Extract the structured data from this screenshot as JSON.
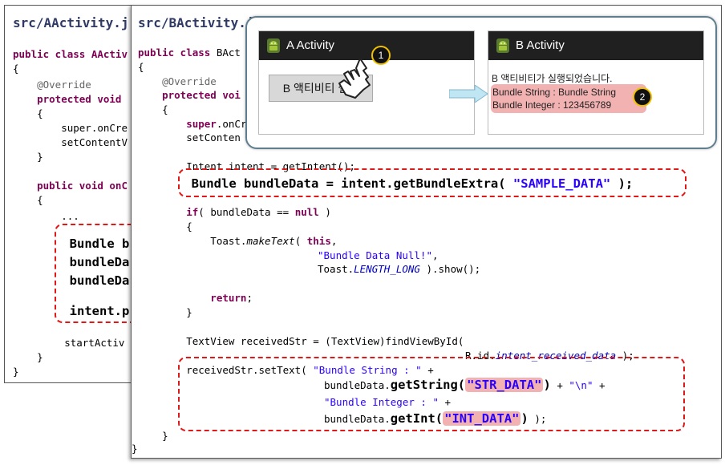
{
  "panelA": {
    "title": "src/AActivity.j",
    "lines": [
      "public class AActiv",
      "{",
      "    @Override",
      "    protected void",
      "    {",
      "        super.onCre",
      "        setContentV",
      "    }",
      "",
      "    public void onC",
      "    {",
      "        ...",
      "",
      "        Bundle b",
      "        bundleDa",
      "        bundleDa",
      "",
      "        intent.p",
      "",
      "        startActiv",
      "    }",
      "}"
    ]
  },
  "panelB": {
    "title": "src/BActivity.j",
    "code": {
      "l1_kw": "public class",
      "l1_rest": " BAct",
      "l2": "{",
      "l3": "    @Override",
      "l4_kw": "    protected voi",
      "l5": "    {",
      "l6_a": "        super",
      "l6_b": ".onCr",
      "l7": "        setConten",
      "l8": "        Intent intent = getIntent();",
      "l9_a": "        Bundle bundleData = intent.getBundleExtra( ",
      "l9_str": "\"SAMPLE_DATA\"",
      "l9_b": " );",
      "l10_kw": "        if",
      "l10_a": "( bundleData == ",
      "l10_null": "null",
      "l10_b": " )",
      "l11": "        {",
      "l12_a": "            Toast.",
      "l12_m": "makeText",
      "l12_b": "( ",
      "l12_this": "this",
      "l12_c": ",",
      "l13_str": "\"Bundle Data Null!\"",
      "l13_b": ",",
      "l14_a": "Toast.",
      "l14_f": "LENGTH_LONG",
      "l14_b": " ).show();",
      "l15_kw": "            return",
      "l15_b": ";",
      "l16": "        }",
      "l17": "        TextView receivedStr = (TextView)findViewById(",
      "l18_a": "R.id.",
      "l18_f": "intent_received_data",
      "l18_b": " );",
      "l19_a": "        receivedStr.setText( ",
      "l19_str": "\"Bundle String : \"",
      "l19_b": " +",
      "l20_a": "bundleData.",
      "l20_m": "getString(",
      "l20_str": "\"STR_DATA\"",
      "l20_c": ")",
      "l20_d": " + ",
      "l20_nl": "\"\\n\"",
      "l20_e": " +",
      "l21_str": "\"Bundle Integer : \"",
      "l21_b": " +",
      "l22_a": "bundleData.",
      "l22_m": "getInt(",
      "l22_str": "\"INT_DATA\"",
      "l22_c": ")",
      "l22_d": " );",
      "l23": "    }",
      "l24": "}"
    }
  },
  "emulator": {
    "screenA": {
      "title": "A Activity",
      "button_label": "B 액티비티 실행",
      "step": "1"
    },
    "screenB": {
      "title": "B Activity",
      "message": "B 액티비티가 실행되었습니다.",
      "line1": "Bundle String : Bundle String",
      "line2": "Bundle Integer : 123456789",
      "step": "2"
    }
  },
  "colors": {
    "keyword": "#7f0055",
    "string": "#2a00ff",
    "highlight": "#e01818",
    "title": "#2f3b66"
  }
}
